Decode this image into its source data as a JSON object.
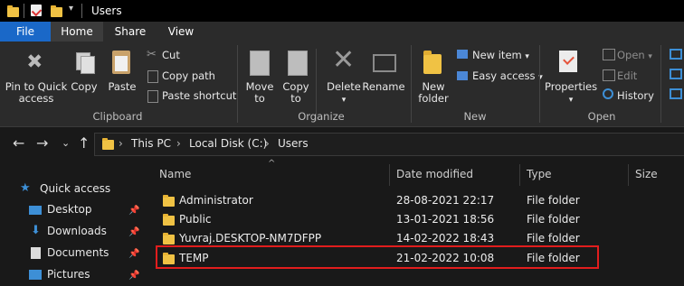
{
  "window": {
    "title": "Users",
    "quick_access_toolbar": [
      "properties-icon",
      "new-folder-icon",
      "customize-dropdown"
    ]
  },
  "tabs": [
    {
      "label": "File"
    },
    {
      "label": "Home",
      "active": true
    },
    {
      "label": "Share"
    },
    {
      "label": "View"
    }
  ],
  "ribbon": {
    "clipboard": {
      "pin_label_1": "Pin to Quick",
      "pin_label_2": "access",
      "copy": "Copy",
      "paste": "Paste",
      "cut": "Cut",
      "copy_path": "Copy path",
      "paste_shortcut": "Paste shortcut",
      "group": "Clipboard"
    },
    "organize": {
      "move_to_1": "Move",
      "move_to_2": "to",
      "copy_to_1": "Copy",
      "copy_to_2": "to",
      "delete": "Delete",
      "rename": "Rename",
      "group": "Organize"
    },
    "new": {
      "new_folder_1": "New",
      "new_folder_2": "folder",
      "new_item": "New item",
      "easy_access": "Easy access",
      "group": "New"
    },
    "open": {
      "properties": "Properties",
      "open": "Open",
      "edit": "Edit",
      "history": "History",
      "group": "Open"
    }
  },
  "address": {
    "breadcrumbs": [
      "This PC",
      "Local Disk (C:)",
      "Users"
    ]
  },
  "sidebar": {
    "items": [
      {
        "label": "Quick access",
        "icon": "star-icon"
      },
      {
        "label": "Desktop",
        "icon": "desktop-icon",
        "pinned": true
      },
      {
        "label": "Downloads",
        "icon": "download-icon",
        "pinned": true
      },
      {
        "label": "Documents",
        "icon": "documents-icon",
        "pinned": true
      },
      {
        "label": "Pictures",
        "icon": "pictures-icon",
        "pinned": true
      }
    ]
  },
  "file_list": {
    "columns": [
      "Name",
      "Date modified",
      "Type",
      "Size"
    ],
    "rows": [
      {
        "name": "Administrator",
        "date": "28-08-2021 22:17",
        "type": "File folder"
      },
      {
        "name": "Public",
        "date": "13-01-2021 18:56",
        "type": "File folder"
      },
      {
        "name": "Yuvraj.DESKTOP-NM7DFPP",
        "date": "14-02-2022 18:43",
        "type": "File folder"
      },
      {
        "name": "TEMP",
        "date": "21-02-2022 10:08",
        "type": "File folder",
        "highlighted": true
      }
    ]
  },
  "colors": {
    "accent": "#1a68c8",
    "highlight_border": "#e11d1d",
    "folder": "#f0c244"
  }
}
